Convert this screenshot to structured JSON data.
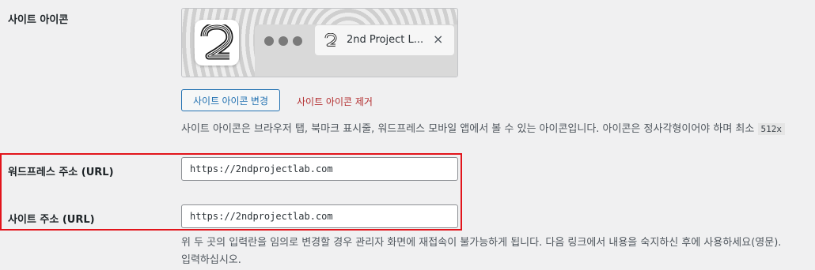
{
  "site_icon": {
    "label": "사이트 아이콘",
    "tab_title": "2nd Project L...",
    "close_glyph": "×",
    "change_button": "사이트 아이콘 변경",
    "remove_link": "사이트 아이콘 제거",
    "description": "사이트 아이콘은 브라우저 탭, 북마크 표시줄, 워드프레스 모바일 앱에서 볼 수 있는 아이콘입니다. 아이콘은 정사각형이어야 하며 최소",
    "size_code": "512x"
  },
  "wordpress_url": {
    "label": "워드프레스 주소 (URL)",
    "value": "https://2ndprojectlab.com"
  },
  "site_url": {
    "label": "사이트 주소 (URL)",
    "value": "https://2ndprojectlab.com"
  },
  "url_notice": {
    "line1": "위 두 곳의 입력란을 임의로 변경할 경우 관리자 화면에 재접속이 불가능하게 됩니다. 다음 링크에서 내용을 숙지하신 후에 사용하세요(영문).",
    "line2": "입력하십시오."
  },
  "colors": {
    "highlight": "#e2141b",
    "link": "#2271b1",
    "remove": "#b32d2e"
  },
  "icons": {
    "logo": "numeral-2-striped-logo",
    "tab_favicon": "numeral-2-favicon",
    "close": "close-icon"
  }
}
